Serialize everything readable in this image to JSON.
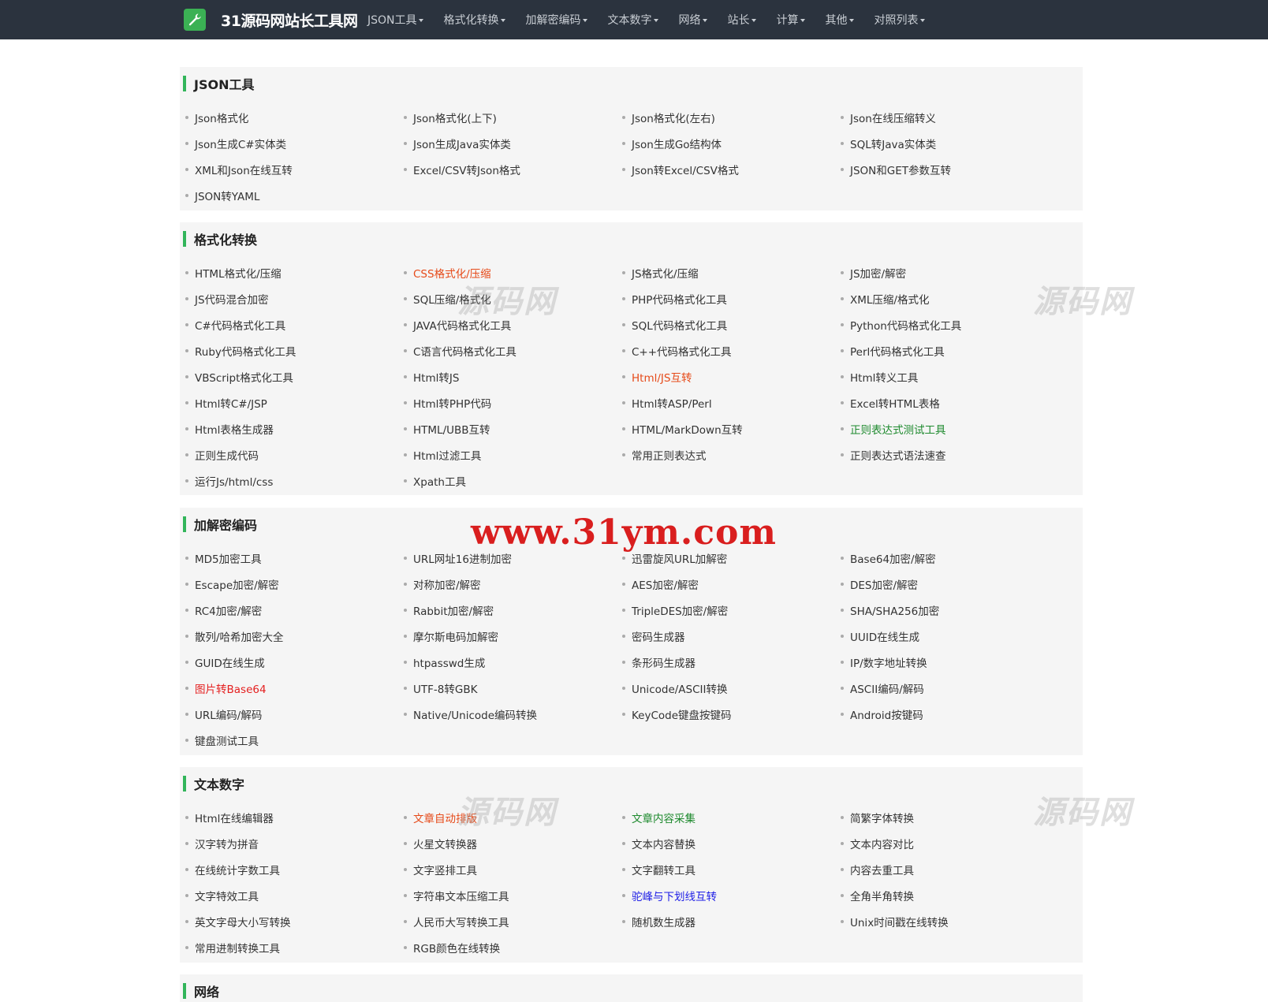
{
  "brand": {
    "name": "31源码网站长工具网"
  },
  "nav": [
    {
      "label": "JSON工具"
    },
    {
      "label": "格式化转换"
    },
    {
      "label": "加解密编码"
    },
    {
      "label": "文本数字"
    },
    {
      "label": "网络"
    },
    {
      "label": "站长"
    },
    {
      "label": "计算"
    },
    {
      "label": "其他"
    },
    {
      "label": "对照列表"
    }
  ],
  "sections": [
    {
      "title": "JSON工具",
      "items": [
        "Json格式化",
        "Json格式化(上下)",
        "Json格式化(左右)",
        "Json在线压缩转义",
        "Json生成C#实体类",
        "Json生成Java实体类",
        "Json生成Go结构体",
        "SQL转Java实体类",
        "XML和Json在线互转",
        "Excel/CSV转Json格式",
        "Json转Excel/CSV格式",
        "JSON和GET参数互转",
        "JSON转YAML"
      ]
    },
    {
      "title": "格式化转换",
      "items": [
        "HTML格式化/压缩",
        "CSS格式化/压缩",
        "JS格式化/压缩",
        "JS加密/解密",
        "JS代码混合加密",
        "SQL压缩/格式化",
        "PHP代码格式化工具",
        "XML压缩/格式化",
        "C#代码格式化工具",
        "JAVA代码格式化工具",
        "SQL代码格式化工具",
        "Python代码格式化工具",
        "Ruby代码格式化工具",
        "C语言代码格式化工具",
        "C++代码格式化工具",
        "Perl代码格式化工具",
        "VBScript格式化工具",
        "Html转JS",
        "Html/JS互转",
        "Html转义工具",
        "Html转C#/JSP",
        "Html转PHP代码",
        "Html转ASP/Perl",
        "Excel转HTML表格",
        "Html表格生成器",
        "HTML/UBB互转",
        "HTML/MarkDown互转",
        "正则表达式测试工具",
        "正则生成代码",
        "Html过滤工具",
        "常用正则表达式",
        "正则表达式语法速查",
        "运行Js/html/css",
        "Xpath工具"
      ]
    },
    {
      "title": "加解密编码",
      "items": [
        "MD5加密工具",
        "URL网址16进制加密",
        "迅雷旋风URL加解密",
        "Base64加密/解密",
        "Escape加密/解密",
        "对称加密/解密",
        "AES加密/解密",
        "DES加密/解密",
        "RC4加密/解密",
        "Rabbit加密/解密",
        "TripleDES加密/解密",
        "SHA/SHA256加密",
        "散列/哈希加密大全",
        "摩尔斯电码加解密",
        "密码生成器",
        "UUID在线生成",
        "GUID在线生成",
        "htpasswd生成",
        "条形码生成器",
        "IP/数字地址转换",
        "图片转Base64",
        "UTF-8转GBK",
        "Unicode/ASCII转换",
        "ASCII编码/解码",
        "URL编码/解码",
        "Native/Unicode编码转换",
        "KeyCode键盘按键码",
        "Android按键码",
        "键盘测试工具"
      ]
    },
    {
      "title": "文本数字",
      "items": [
        "Html在线编辑器",
        "文章自动排版",
        "文章内容采集",
        "简繁字体转换",
        "汉字转为拼音",
        "火星文转换器",
        "文本内容替换",
        "文本内容对比",
        "在线统计字数工具",
        "文字竖排工具",
        "文字翻转工具",
        "内容去重工具",
        "文字特效工具",
        "字符串文本压缩工具",
        "驼峰与下划线互转",
        "全角半角转换",
        "英文字母大小写转换",
        "人民币大写转换工具",
        "随机数生成器",
        "Unix时间戳在线转换",
        "常用进制转换工具",
        "RGB颜色在线转换"
      ]
    },
    {
      "title": "网络",
      "items": []
    }
  ],
  "highlights": [
    {
      "section": 1,
      "item": 1,
      "color": "#e64a19"
    },
    {
      "section": 1,
      "item": 18,
      "color": "#e64a19"
    },
    {
      "section": 1,
      "item": 27,
      "color": "#1e8a2e"
    },
    {
      "section": 2,
      "item": 20,
      "color": "#e41f1f"
    },
    {
      "section": 3,
      "item": 1,
      "color": "#e64a19"
    },
    {
      "section": 3,
      "item": 2,
      "color": "#1e8a2e"
    },
    {
      "section": 3,
      "item": 14,
      "color": "#1e1ee6"
    }
  ],
  "watermarks": [
    "源码网",
    "源码网",
    "源码网",
    "源码网"
  ],
  "site_mark": "www.31ym.com"
}
